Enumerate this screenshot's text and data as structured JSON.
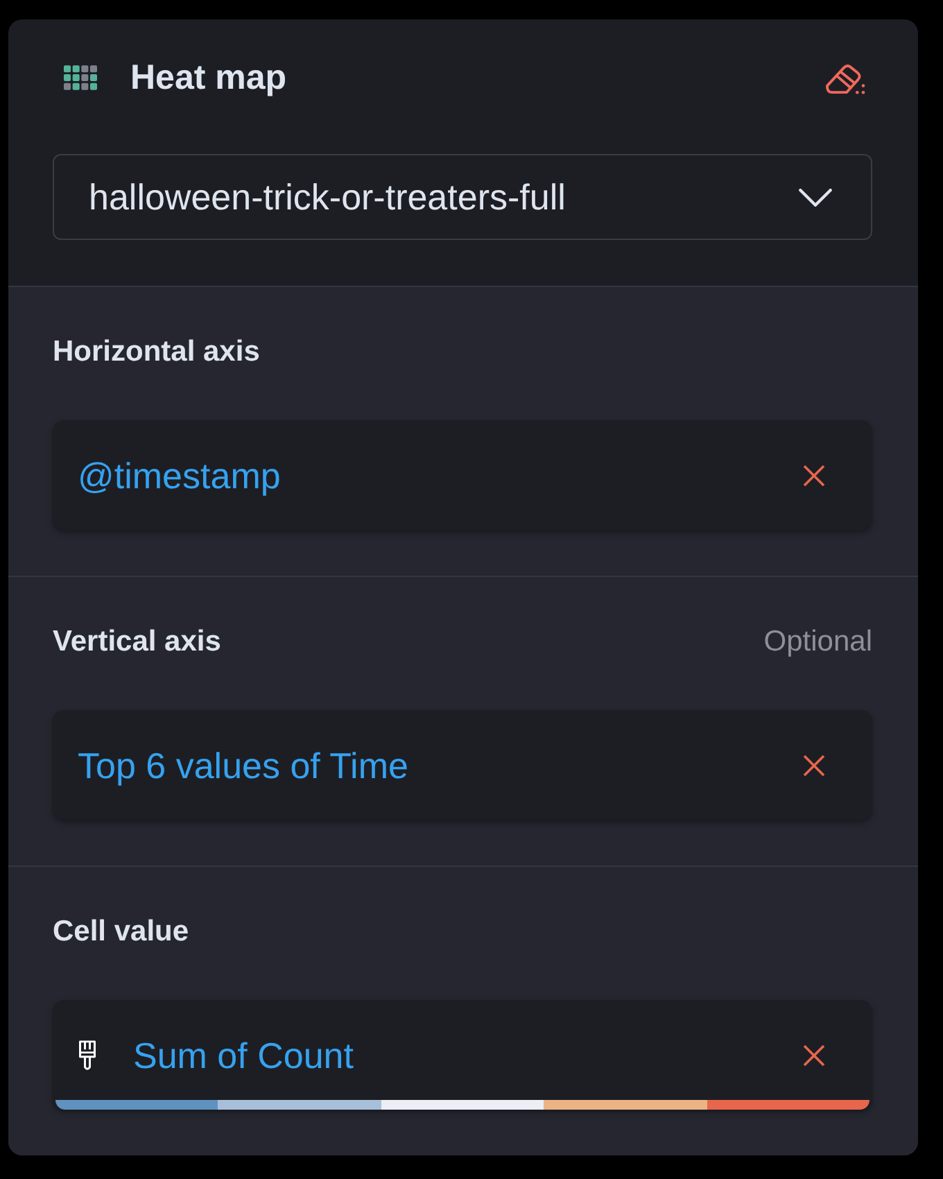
{
  "layer": {
    "title": "Heat map",
    "data_view": "halloween-trick-or-treaters-full"
  },
  "sections": [
    {
      "label": "Horizontal axis",
      "value": "@timestamp"
    },
    {
      "label": "Vertical axis",
      "hint": "Optional",
      "value": "Top 6 values of Time"
    },
    {
      "label": "Cell value",
      "value": "Sum of Count",
      "palette": [
        {
          "color": "#6092c0"
        },
        {
          "color": "#a8bfda"
        },
        {
          "color": "#ebeff5"
        },
        {
          "color": "#ecb385"
        },
        {
          "color": "#e7664c"
        }
      ]
    }
  ]
}
